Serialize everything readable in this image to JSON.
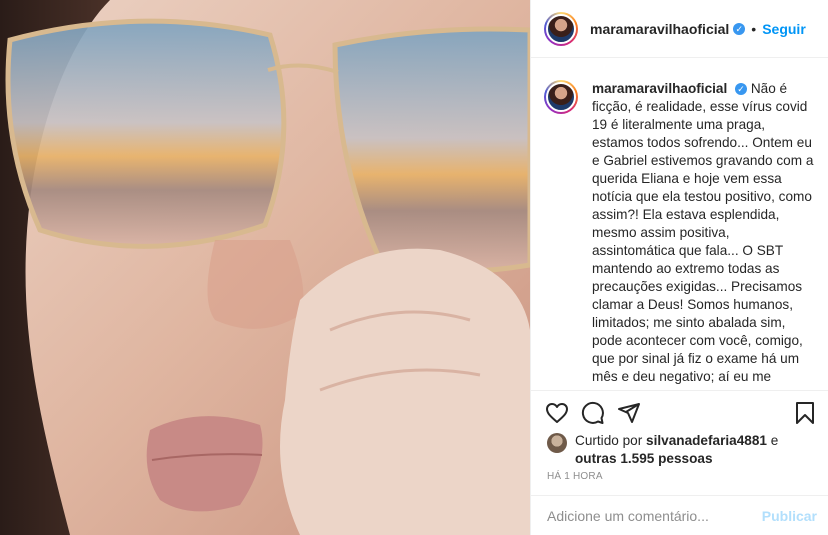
{
  "post": {
    "image_alt": "Close-up selfie with glasses reflecting a sunset"
  },
  "header": {
    "username": "maramaravilhaoficial",
    "verified_icon": "verified-badge-icon",
    "separator": "•",
    "follow_label": "Seguir"
  },
  "caption": {
    "username": "maramaravilhaoficial",
    "text": "Não é ficção, é realidade, esse vírus covid 19 é literalmente uma praga, estamos todos sofrendo... Ontem eu e Gabriel estivemos gravando com a querida Eliana e hoje vem essa notícia que ela testou positivo, como assim?! Ela estava esplendida, mesmo assim positiva, assintomática que fala... O SBT mantendo ao extremo todas as precauções exigidas... Precisamos clamar a Deus! Somos humanos, limitados; me sinto abalada sim, pode acontecer com você, comigo, que por sinal já fiz o exame há um mês e deu negativo; aí eu me pergunto: terei que fazer o exame quantas vezes mais?! O mundo está doente, estamos doentes! Vamos manter os"
  },
  "actions": {
    "like_icon": "heart-icon",
    "comment_icon": "comment-icon",
    "share_icon": "send-icon",
    "save_icon": "bookmark-icon"
  },
  "likes": {
    "prefix": "Curtido por ",
    "user": "silvanadefaria4881",
    "middle": " e ",
    "others": "outras 1.595 pessoas"
  },
  "time": "HÁ 1 HORA",
  "comment": {
    "placeholder": "Adicione um comentário...",
    "publish_label": "Publicar"
  },
  "colors": {
    "accent": "#0095f6",
    "publish_disabled": "#b2dffc",
    "text": "#262626",
    "muted": "#8e8e8e",
    "border": "#efefef"
  }
}
